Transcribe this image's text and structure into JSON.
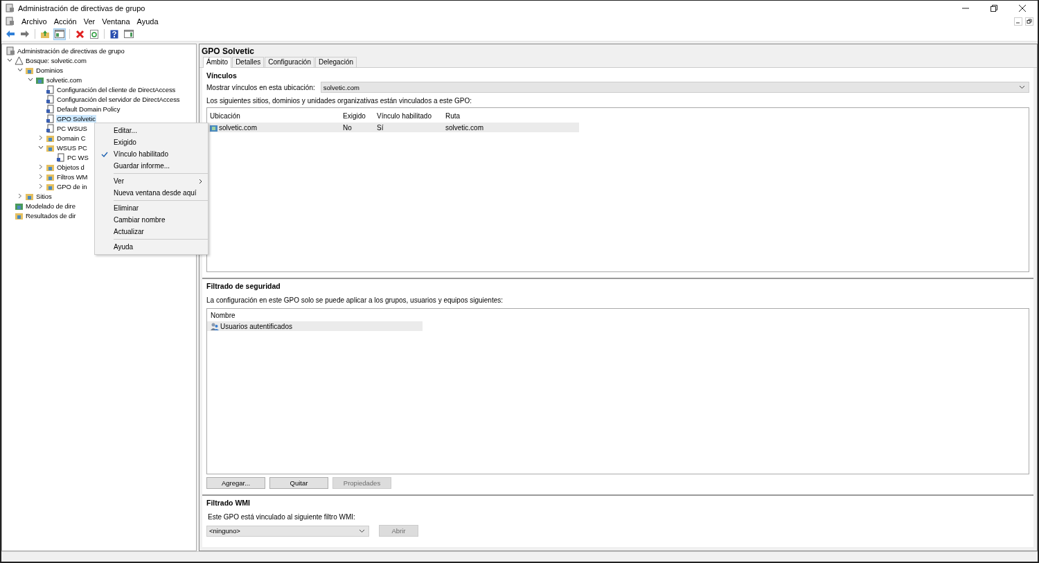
{
  "window": {
    "title": "Administración de directivas de grupo"
  },
  "menu_bar": [
    "Archivo",
    "Acción",
    "Ver",
    "Ventana",
    "Ayuda"
  ],
  "toolbar": [
    {
      "kind": "back",
      "pressed": false
    },
    {
      "kind": "forward",
      "pressed": false
    },
    {
      "kind": "up",
      "pressed": false
    },
    {
      "kind": "tree",
      "pressed": true
    },
    {
      "kind": "delete",
      "pressed": false
    },
    {
      "kind": "refresh",
      "pressed": false
    },
    {
      "kind": "help",
      "pressed": false
    },
    {
      "kind": "pane",
      "pressed": false
    }
  ],
  "tree": [
    {
      "label": "Administración de directivas de grupo",
      "kind": "console",
      "selected": false,
      "children": [
        {
          "label": "Bosque: solvetic.com",
          "kind": "forest",
          "expanded": true,
          "selected": false,
          "children": [
            {
              "label": "Dominios",
              "kind": "folder",
              "expanded": true,
              "selected": false,
              "children": [
                {
                  "label": "solvetic.com",
                  "kind": "domain",
                  "expanded": true,
                  "selected": false,
                  "children": [
                    {
                      "label": "Configuración del cliente de DirectAccess",
                      "kind": "gpo",
                      "selected": false
                    },
                    {
                      "label": "Configuración del servidor de DirectAccess",
                      "kind": "gpo",
                      "selected": false
                    },
                    {
                      "label": "Default Domain Policy",
                      "kind": "gpo",
                      "selected": false
                    },
                    {
                      "label": "GPO Solvetic",
                      "kind": "gpo",
                      "selected": true
                    },
                    {
                      "label": "PC WSUS",
                      "kind": "gpo",
                      "selected": false
                    },
                    {
                      "label": "Domain C",
                      "kind": "folder",
                      "expanded": false,
                      "selected": false
                    },
                    {
                      "label": "WSUS PC",
                      "kind": "folder",
                      "expanded": true,
                      "selected": false,
                      "children": [
                        {
                          "label": "PC WS",
                          "kind": "gpo",
                          "selected": false
                        }
                      ]
                    },
                    {
                      "label": "Objetos d",
                      "kind": "folder",
                      "expanded": false,
                      "selected": false
                    },
                    {
                      "label": "Filtros WM",
                      "kind": "folder",
                      "expanded": false,
                      "selected": false
                    },
                    {
                      "label": "GPO de in",
                      "kind": "folder",
                      "expanded": false,
                      "selected": false
                    }
                  ]
                }
              ]
            },
            {
              "label": "Sitios",
              "kind": "folder",
              "expanded": false,
              "selected": false
            }
          ]
        },
        {
          "label": "Modelado de dire",
          "kind": "domain",
          "selected": false
        },
        {
          "label": "Resultados de dir",
          "kind": "folder",
          "selected": false
        }
      ]
    }
  ],
  "context_menu": [
    [
      {
        "label": "Editar...",
        "checked": false,
        "submenu": false
      },
      {
        "label": "Exigido",
        "checked": false,
        "submenu": false
      },
      {
        "label": "Vínculo habilitado",
        "checked": true,
        "submenu": false
      },
      {
        "label": "Guardar informe...",
        "checked": false,
        "submenu": false
      }
    ],
    [
      {
        "label": "Ver",
        "checked": false,
        "submenu": true
      },
      {
        "label": "Nueva ventana desde aquí",
        "checked": false,
        "submenu": false
      }
    ],
    [
      {
        "label": "Eliminar",
        "checked": false,
        "submenu": false
      },
      {
        "label": "Cambiar nombre",
        "checked": false,
        "submenu": false
      },
      {
        "label": "Actualizar",
        "checked": false,
        "submenu": false
      }
    ],
    [
      {
        "label": "Ayuda",
        "checked": false,
        "submenu": false
      }
    ]
  ],
  "details": {
    "title": "GPO Solvetic",
    "tabs": [
      {
        "label": "Ámbito",
        "selected": true
      },
      {
        "label": "Detalles",
        "selected": false
      },
      {
        "label": "Configuración",
        "selected": false
      },
      {
        "label": "Delegación",
        "selected": false
      }
    ],
    "links": {
      "heading": "Vínculos",
      "location_label": "Mostrar vínculos en esta ubicación:",
      "location_value": "solvetic.com",
      "description": "Los siguientes sitios, dominios y unidades organizativas están vinculados a este GPO:",
      "columns": [
        "Ubicación",
        "Exigido",
        "Vínculo habilitado",
        "Ruta"
      ],
      "rows": [
        [
          "solvetic.com",
          "No",
          "Sí",
          "solvetic.com"
        ]
      ]
    },
    "security": {
      "heading": "Filtrado de seguridad",
      "description": "La configuración en este GPO solo se puede aplicar a los grupos, usuarios y equipos siguientes:",
      "columns": [
        "Nombre"
      ],
      "rows": [
        "Usuarios autentificados"
      ],
      "buttons": [
        {
          "label": "Agregar...",
          "disabled": false
        },
        {
          "label": "Quitar",
          "disabled": false
        },
        {
          "label": "Propiedades",
          "disabled": true
        }
      ]
    },
    "wmi": {
      "heading": "Filtrado WMI",
      "description": "Este GPO está vinculado al siguiente filtro WMI:",
      "value": "<ninguno>",
      "button": {
        "label": "Abrir",
        "disabled": true
      }
    }
  }
}
